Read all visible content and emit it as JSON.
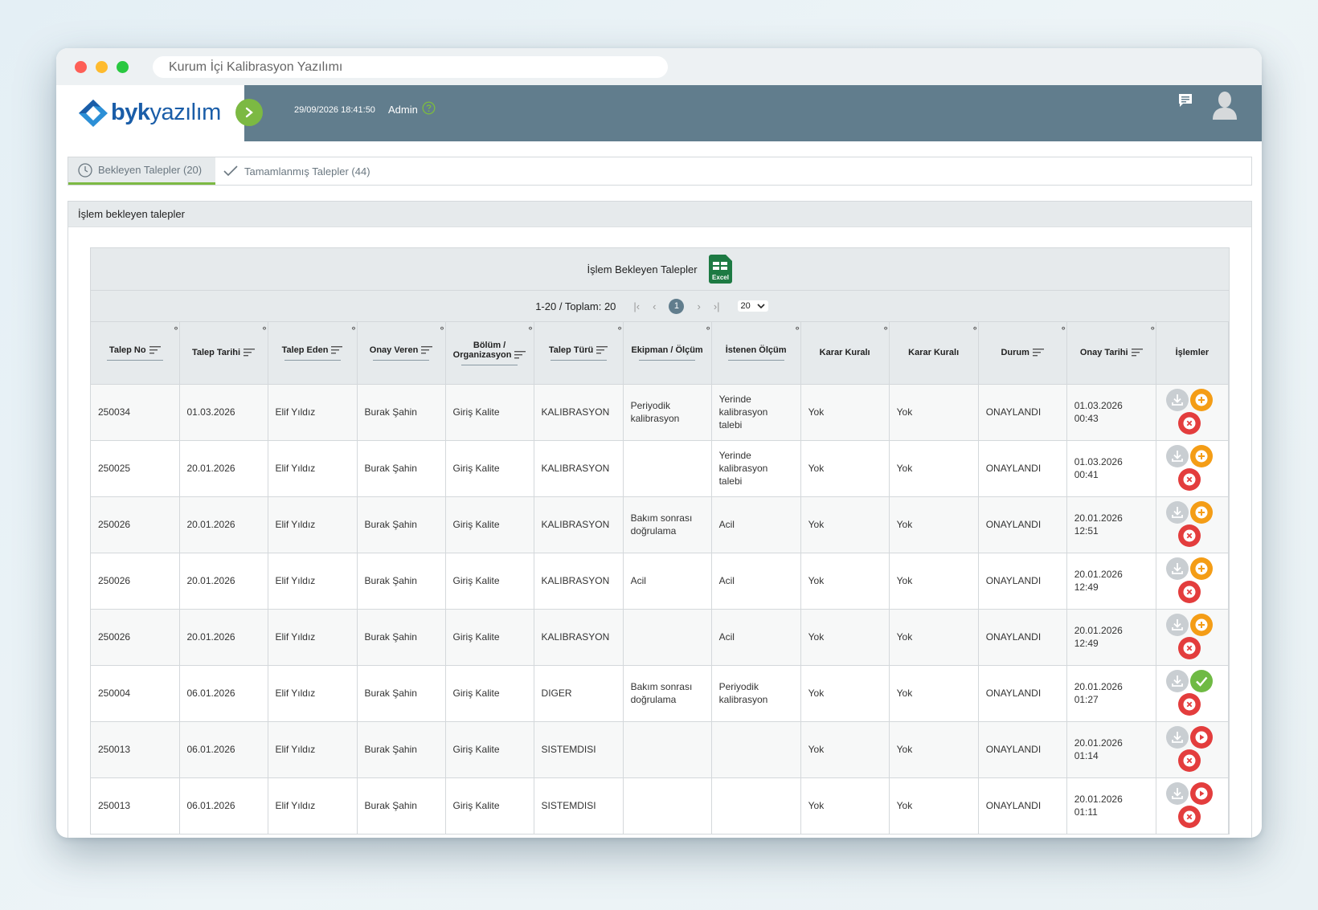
{
  "window": {
    "title": "Kurum İçi Kalibrasyon Yazılımı"
  },
  "header": {
    "logo_bold": "byk",
    "logo_light": "yazılım",
    "datetime": "29/09/2026 18:41:50",
    "user": "Admin"
  },
  "tabs": [
    {
      "label": "Bekleyen Talepler (20)",
      "active": true
    },
    {
      "label": "Tamamlanmış Talepler (44)",
      "active": false
    }
  ],
  "panel": {
    "title": "İşlem bekleyen talepler"
  },
  "grid": {
    "title": "İşlem Bekleyen Talepler",
    "excel_label": "Excel",
    "pager": {
      "summary": "1-20 / Toplam: 20",
      "current_page": "1",
      "page_size": "20"
    },
    "columns": [
      "Talep No",
      "Talep Tarihi",
      "Talep Eden",
      "Onay Veren",
      "Bölüm / Organizasyon",
      "Talep Türü",
      "Ekipman / Ölçüm",
      "İstenen Ölçüm",
      "Karar Kuralı",
      "Karar Kuralı",
      "Durum",
      "Onay Tarihi",
      "İşlemler"
    ],
    "rows": [
      [
        "250034",
        "01.03.2026",
        "Elif Yıldız",
        "Burak Şahin",
        "Giriş Kalite",
        "KALIBRASYON",
        "Periyodik kalibrasyon",
        "Yerinde kalibrasyon talebi",
        "Yok",
        "Yok",
        "ONAYLANDI",
        "01.03.2026 00:43",
        "add"
      ],
      [
        "250025",
        "20.01.2026",
        "Elif Yıldız",
        "Burak Şahin",
        "Giriş Kalite",
        "KALIBRASYON",
        "",
        "Yerinde kalibrasyon talebi",
        "Yok",
        "Yok",
        "ONAYLANDI",
        "01.03.2026 00:41",
        "add"
      ],
      [
        "250026",
        "20.01.2026",
        "Elif Yıldız",
        "Burak Şahin",
        "Giriş Kalite",
        "KALIBRASYON",
        "Bakım sonrası doğrulama",
        "Acil",
        "Yok",
        "Yok",
        "ONAYLANDI",
        "20.01.2026 12:51",
        "add"
      ],
      [
        "250026",
        "20.01.2026",
        "Elif Yıldız",
        "Burak Şahin",
        "Giriş Kalite",
        "KALIBRASYON",
        "Acil",
        "Acil",
        "Yok",
        "Yok",
        "ONAYLANDI",
        "20.01.2026 12:49",
        "add"
      ],
      [
        "250026",
        "20.01.2026",
        "Elif Yıldız",
        "Burak Şahin",
        "Giriş Kalite",
        "KALIBRASYON",
        "",
        "Acil",
        "Yok",
        "Yok",
        "ONAYLANDI",
        "20.01.2026 12:49",
        "add"
      ],
      [
        "250004",
        "06.01.2026",
        "Elif Yıldız",
        "Burak Şahin",
        "Giriş Kalite",
        "DIGER",
        "Bakım sonrası doğrulama",
        "Periyodik kalibrasyon",
        "Yok",
        "Yok",
        "ONAYLANDI",
        "20.01.2026 01:27",
        "ok"
      ],
      [
        "250013",
        "06.01.2026",
        "Elif Yıldız",
        "Burak Şahin",
        "Giriş Kalite",
        "SISTEMDISI",
        "",
        "",
        "Yok",
        "Yok",
        "ONAYLANDI",
        "20.01.2026 01:14",
        "play"
      ],
      [
        "250013",
        "06.01.2026",
        "Elif Yıldız",
        "Burak Şahin",
        "Giriş Kalite",
        "SISTEMDISI",
        "",
        "",
        "Yok",
        "Yok",
        "ONAYLANDI",
        "20.01.2026 01:11",
        "play"
      ]
    ]
  },
  "colors": {
    "header_bg": "#617d8d",
    "accent_green": "#7cb943",
    "action_orange": "#f49d16",
    "action_red": "#e33d3d",
    "action_green": "#6fba44",
    "action_grey": "#c9ced2"
  },
  "icons": {
    "tab_active": "clock-icon",
    "tab_second": "check-icon",
    "excel": "excel-icon",
    "row_download": "download-icon",
    "row_add": "plus-icon",
    "row_ok": "check-icon",
    "row_play": "play-icon",
    "row_cancel": "x-icon"
  }
}
